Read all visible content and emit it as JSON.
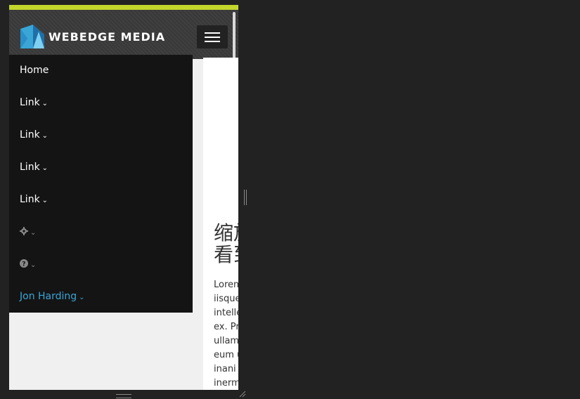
{
  "brand": {
    "name": "WEBEDGE MEDIA",
    "accent": "#c2d62b"
  },
  "menu": {
    "items": [
      {
        "label": "Home",
        "chevron": ""
      },
      {
        "label": "Link",
        "chevron": "⌄"
      },
      {
        "label": "Link",
        "chevron": "⌄"
      },
      {
        "label": "Link",
        "chevron": "⌄"
      },
      {
        "label": "Link",
        "chevron": "⌄"
      }
    ],
    "settings_icon": "gear-icon",
    "help_icon": "question-circle-icon",
    "user_label": "Jon Harding",
    "user_color": "#39a6d7"
  },
  "content": {
    "headline_line1": "缩放",
    "headline_line2": "看到",
    "body_lines": [
      "Lorem",
      "iisque",
      "intelle",
      "ex. Pr",
      "ullam",
      "eum u",
      "inani",
      "inerm"
    ]
  }
}
